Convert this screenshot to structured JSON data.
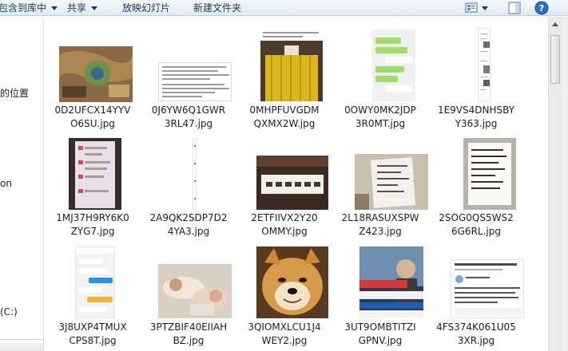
{
  "toolbar": {
    "include_label": "包含到库中",
    "share_label": "共享",
    "slideshow_label": "放映幻灯片",
    "new_folder_label": "新建文件夹"
  },
  "nav": {
    "items": [
      "的位置",
      "on",
      "(C:)"
    ]
  },
  "files": [
    {
      "name_line1": "0D2UFCX14YYV",
      "name_line2": "O6SU.jpg",
      "thumb": "game-map"
    },
    {
      "name_line1": "0J6YW6Q1GWR",
      "name_line2": "3RL47.jpg",
      "thumb": "text-doc"
    },
    {
      "name_line1": "0MHPFUVGDM",
      "name_line2": "QXMX2W.jpg",
      "thumb": "yellow-curtain"
    },
    {
      "name_line1": "0OWY0MK2JDP",
      "name_line2": "3R0MT.jpg",
      "thumb": "chat-green"
    },
    {
      "name_line1": "1E9VS4DNHSBY",
      "name_line2": "Y363.jpg",
      "thumb": "long-narrow"
    },
    {
      "name_line1": "1MJ37H9RY6K0",
      "name_line2": "ZYG7.jpg",
      "thumb": "phone-chat"
    },
    {
      "name_line1": "2A9QK2SDP7D2",
      "name_line2": "4YA3.jpg",
      "thumb": "very-narrow"
    },
    {
      "name_line1": "2ETFIIVX2Y20",
      "name_line2": "OMMY.jpg",
      "thumb": "sign-board"
    },
    {
      "name_line1": "2L18RASUXSPW",
      "name_line2": "Z423.jpg",
      "thumb": "paper-note"
    },
    {
      "name_line1": "2SOG0QS5WS2",
      "name_line2": "6G6RL.jpg",
      "thumb": "handwritten"
    },
    {
      "name_line1": "3J8UXP4TMUX",
      "name_line2": "CPS8T.jpg",
      "thumb": "chat-blue"
    },
    {
      "name_line1": "3PTZBIF40EIIAH",
      "name_line2": "BZ.jpg",
      "thumb": "sleeping"
    },
    {
      "name_line1": "3QIOMXLCU1J4",
      "name_line2": "WEY2.jpg",
      "thumb": "doge"
    },
    {
      "name_line1": "3UT9OMBTITZI",
      "name_line2": "GPNV.jpg",
      "thumb": "tv-news"
    },
    {
      "name_line1": "4FS374K061U05",
      "name_line2": "3XR.jpg",
      "thumb": "weibo"
    }
  ],
  "colors": {
    "toolbar_text": "#1e395b",
    "file_text": "#1e1e1e"
  }
}
